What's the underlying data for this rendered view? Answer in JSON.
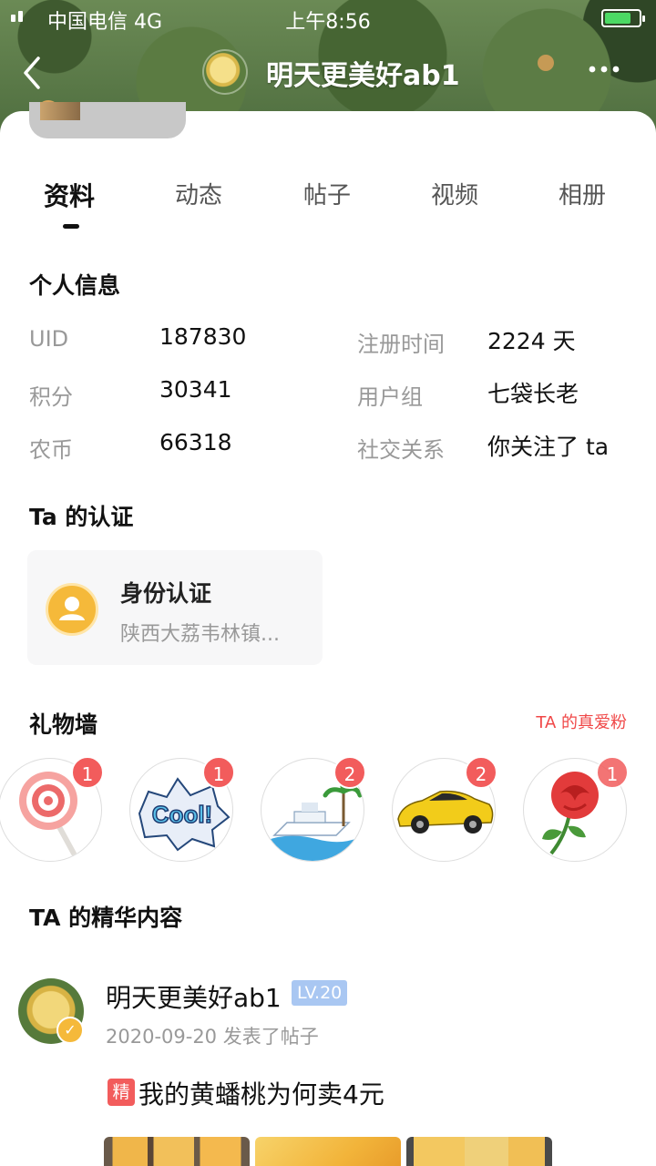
{
  "status_bar": {
    "carrier": "中国电信  4G",
    "time": "上午8:56"
  },
  "header": {
    "title": "明天更美好ab1"
  },
  "tabs": [
    {
      "label": "资料"
    },
    {
      "label": "动态"
    },
    {
      "label": "帖子"
    },
    {
      "label": "视频"
    },
    {
      "label": "相册"
    }
  ],
  "personal_info": {
    "title": "个人信息",
    "rows": [
      {
        "label": "UID",
        "value": "187830"
      },
      {
        "label": "积分",
        "value": "30341"
      },
      {
        "label": "农币",
        "value": "66318"
      },
      {
        "label": "注册时间",
        "value": "2224 天"
      },
      {
        "label": "用户组",
        "value": "七袋长老"
      },
      {
        "label": "社交关系",
        "value": "你关注了 ta"
      }
    ]
  },
  "certification": {
    "title": "Ta 的认证",
    "card_title": "身份认证",
    "card_sub": "陕西大荔韦林镇..."
  },
  "gift_wall": {
    "title": "礼物墙",
    "fans_link": "TA 的真爱粉",
    "gifts": [
      {
        "icon": "lollipop-icon",
        "count": "1"
      },
      {
        "icon": "cool-sticker-icon",
        "count": "1"
      },
      {
        "icon": "yacht-icon",
        "count": "2"
      },
      {
        "icon": "sports-car-icon",
        "count": "2"
      },
      {
        "icon": "rose-icon",
        "count": "1"
      }
    ]
  },
  "featured": {
    "title": "TA 的精华内容",
    "post": {
      "author": "明天更美好ab1",
      "level": "LV.20",
      "meta": "2020-09-20 发表了帖子",
      "tag": "精",
      "title": "我的黄蟠桃为何卖4元"
    }
  }
}
